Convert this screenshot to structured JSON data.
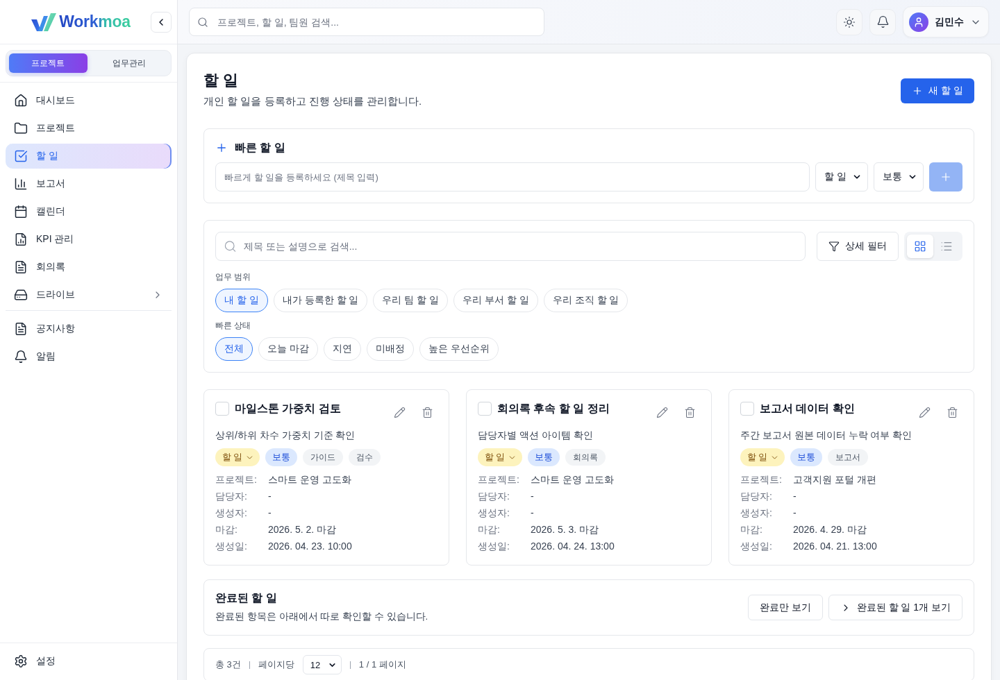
{
  "sidebar": {
    "logo": "Workmoa",
    "mode_tabs": [
      {
        "label": "프로젝트",
        "selected": true
      },
      {
        "label": "업무관리",
        "selected": false
      }
    ],
    "nav": [
      {
        "label": "대시보드",
        "kind": "link",
        "selected": false
      },
      {
        "label": "프로젝트",
        "kind": "link",
        "selected": false
      },
      {
        "label": "할 일",
        "kind": "link",
        "selected": true
      },
      {
        "label": "보고서",
        "kind": "link",
        "selected": false
      },
      {
        "label": "캘린더",
        "kind": "link",
        "selected": false
      },
      {
        "label": "KPI 관리",
        "kind": "link",
        "selected": false
      },
      {
        "label": "회의록",
        "kind": "link",
        "selected": false
      },
      {
        "label": "드라이브",
        "kind": "group",
        "selected": false,
        "expanded": false
      }
    ],
    "nav_secondary": [
      {
        "label": "공지사항",
        "selected": false
      },
      {
        "label": "알림",
        "selected": false
      }
    ],
    "settings": {
      "label": "설정",
      "selected": false
    }
  },
  "header": {
    "search": {
      "placeholder": "프로젝트, 할 일, 팀원 검색..."
    },
    "user": {
      "name": "김민수"
    }
  },
  "page": {
    "title": "할 일",
    "subtitle": "개인 할 일을 등록하고 진행 상태를 관리합니다.",
    "new_button": "새 할 일"
  },
  "quick_add": {
    "title": "빠른 할 일",
    "input": {
      "placeholder": "빠르게 할 일을 등록하세요 (제목 입력)"
    },
    "type_select": "할 일",
    "priority_select": "보통",
    "add_button": {
      "disabled": true
    }
  },
  "filters": {
    "search": {
      "placeholder": "제목 또는 설명으로 검색..."
    },
    "detail_filter_button": "상세 필터",
    "view_modes": [
      {
        "selected": true
      },
      {
        "selected": false
      }
    ],
    "scope": {
      "label": "업무 범위",
      "chips": [
        {
          "label": "내 할 일",
          "selected": true
        },
        {
          "label": "내가 등록한 할 일",
          "selected": false
        },
        {
          "label": "우리 팀 할 일",
          "selected": false
        },
        {
          "label": "우리 부서 할 일",
          "selected": false
        },
        {
          "label": "우리 조직 할 일",
          "selected": false
        }
      ]
    },
    "quick_status": {
      "label": "빠른 상태",
      "chips": [
        {
          "label": "전체",
          "selected": true
        },
        {
          "label": "오늘 마감",
          "selected": false
        },
        {
          "label": "지연",
          "selected": false
        },
        {
          "label": "미배정",
          "selected": false
        },
        {
          "label": "높은 우선순위",
          "selected": false
        }
      ]
    }
  },
  "tasks": [
    {
      "title": "마일스톤 가중치 검토",
      "checked": false,
      "description": "상위/하위 차수 가중치 기준 확인",
      "status": "할 일",
      "priority": "보통",
      "tags": [
        "가이드",
        "검수"
      ],
      "fields": [
        {
          "label": "프로젝트:",
          "value": "스마트 운영 고도화"
        },
        {
          "label": "담당자:",
          "value": "-"
        },
        {
          "label": "생성자:",
          "value": "-"
        },
        {
          "label": "마감:",
          "value": "2026. 5. 2. 마감"
        },
        {
          "label": "생성일:",
          "value": "2026. 04. 23. 10:00"
        }
      ]
    },
    {
      "title": "회의록 후속 할 일 정리",
      "checked": false,
      "description": "담당자별 액션 아이템 확인",
      "status": "할 일",
      "priority": "보통",
      "tags": [
        "회의록"
      ],
      "fields": [
        {
          "label": "프로젝트:",
          "value": "스마트 운영 고도화"
        },
        {
          "label": "담당자:",
          "value": "-"
        },
        {
          "label": "생성자:",
          "value": "-"
        },
        {
          "label": "마감:",
          "value": "2026. 5. 3. 마감"
        },
        {
          "label": "생성일:",
          "value": "2026. 04. 24. 13:00"
        }
      ]
    },
    {
      "title": "보고서 데이터 확인",
      "checked": false,
      "description": "주간 보고서 원본 데이터 누락 여부 확인",
      "status": "할 일",
      "priority": "보통",
      "tags": [
        "보고서"
      ],
      "fields": [
        {
          "label": "프로젝트:",
          "value": "고객지원 포털 개편"
        },
        {
          "label": "담당자:",
          "value": "-"
        },
        {
          "label": "생성자:",
          "value": "-"
        },
        {
          "label": "마감:",
          "value": "2026. 4. 29. 마감"
        },
        {
          "label": "생성일:",
          "value": "2026. 04. 21. 13:00"
        }
      ]
    }
  ],
  "completed": {
    "title": "완료된 할 일",
    "description": "완료된 항목은 아래에서 따로 확인할 수 있습니다.",
    "only_button": "완료만 보기",
    "expand_button": {
      "label": "완료된 할 일 1개 보기",
      "expanded": false
    }
  },
  "pagination": {
    "total": "총 3건",
    "per_page_label": "페이지당",
    "page_size": "12",
    "page_info": "1 / 1 페이지"
  }
}
